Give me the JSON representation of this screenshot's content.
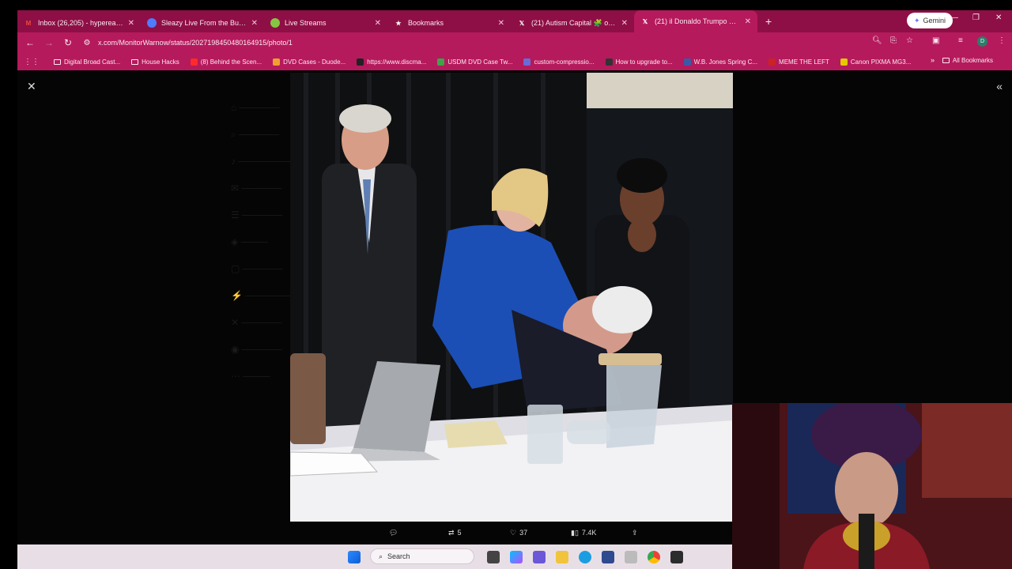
{
  "browser": {
    "tabs": [
      {
        "title": "Inbox (26,205) - hyperealprod...",
        "icon": "gmail-icon",
        "color": "#e84a3c",
        "active": false
      },
      {
        "title": "Sleazy Live From the Bunker 2/...",
        "icon": "rumble-icon",
        "color": "#4d7cff",
        "active": false
      },
      {
        "title": "Live Streams",
        "icon": "live-streams-icon",
        "color": "#85c742",
        "active": false
      },
      {
        "title": "Bookmarks",
        "icon": "star-icon",
        "color": "#ffffff",
        "active": false
      },
      {
        "title": "(21) Autism Capital 🧩 on X: \"...",
        "icon": "x-icon",
        "color": "#ffffff",
        "active": false
      },
      {
        "title": "(21) il Donaldo Trumpo on X: \"...",
        "icon": "x-icon",
        "color": "#ffffff",
        "active": true
      }
    ],
    "new_tab_label": "+",
    "gemini_label": "Gemini",
    "url": "x.com/MonitorWarnow/status/2027198450480164915/photo/1",
    "bookmarks": [
      {
        "label": "Digital Broad Cast...",
        "icon": "folder-icon",
        "color": ""
      },
      {
        "label": "House Hacks",
        "icon": "folder-icon",
        "color": ""
      },
      {
        "label": "(8) Behind the Scen...",
        "icon": "youtube-icon",
        "color": "#ff2a2a"
      },
      {
        "label": "DVD Cases - Duode...",
        "icon": "site-icon",
        "color": "#f0a030"
      },
      {
        "label": "https://www.discma...",
        "icon": "site-icon",
        "color": "#222222"
      },
      {
        "label": "USDM DVD Case Tw...",
        "icon": "site-icon",
        "color": "#3ea34a"
      },
      {
        "label": "custom-compressio...",
        "icon": "site-icon",
        "color": "#6b6bd6"
      },
      {
        "label": "How to upgrade to...",
        "icon": "site-icon",
        "color": "#333333"
      },
      {
        "label": "W.B. Jones Spring C...",
        "icon": "site-icon",
        "color": "#3a5aa8"
      },
      {
        "label": "MEME THE LEFT",
        "icon": "site-icon",
        "color": "#cc2222"
      },
      {
        "label": "Canon PIXMA MG3...",
        "icon": "site-icon",
        "color": "#e6c800"
      }
    ],
    "all_bookmarks_label": "All Bookmarks"
  },
  "viewer": {
    "stats": {
      "reposts": "5",
      "likes": "37",
      "views": "7.4K"
    }
  },
  "taskbar": {
    "search_label": "Search"
  },
  "colors": {
    "tab_strip": "#8e0f45",
    "toolbar": "#b51a5c",
    "taskbar": "#e8dfe6"
  }
}
